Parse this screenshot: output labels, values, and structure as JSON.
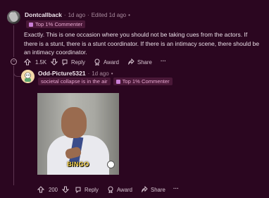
{
  "comment": {
    "username": "Dontcallback",
    "separator": "·",
    "time": "1d ago",
    "edited": "Edited 1d ago",
    "dot_more": "•",
    "flair": "Top 1% Commenter",
    "body": "Exactly. This is one occasion where you should not be taking cues from the actors. If there is a stunt, there is a stunt coordinator. If there is an intimacy scene, there should be an intimacy coordinator.",
    "votes": "1.5K",
    "reply_label": "Reply",
    "award_label": "Award",
    "share_label": "Share",
    "more_label": "···",
    "collapse_symbol": "−"
  },
  "reply": {
    "username": "Odd-Picture5321",
    "separator": "·",
    "time": "1d ago",
    "dot_more": "•",
    "user_flair": "societal collapse is in the air",
    "flair": "Top 1% Commenter",
    "gif_caption": "BINGO",
    "votes": "200",
    "reply_label": "Reply",
    "award_label": "Award",
    "share_label": "Share",
    "more_label": "···"
  },
  "colors": {
    "background": "#2b0620",
    "flair_bg": "#4a1838",
    "flair_text": "#e7a7d0",
    "gif_caption": "#ffd94a"
  }
}
